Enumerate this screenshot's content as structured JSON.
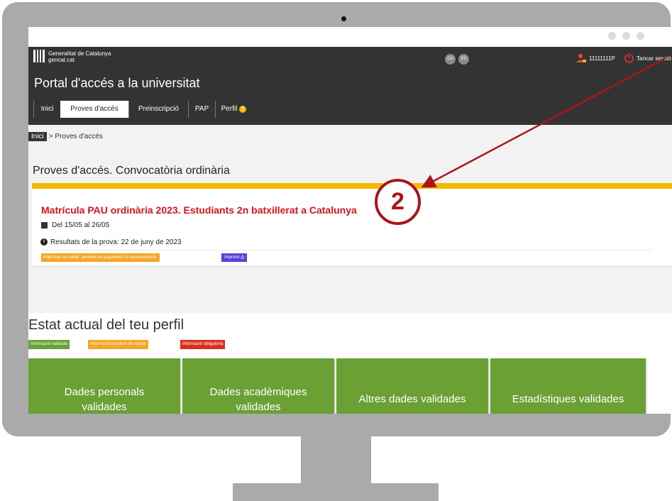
{
  "header": {
    "org_line1": "Generalitat de Catalunya",
    "org_line2": "gencat.cat",
    "lang_ca": "CA",
    "lang_es": "ES",
    "user_id": "11111111P",
    "logout": "Tancar sessió",
    "portal_title": "Portal d'accés a la universitat"
  },
  "tabs": [
    {
      "label": "Inici"
    },
    {
      "label": "Proves d'accés"
    },
    {
      "label": "Preinscripció"
    },
    {
      "label": "PAP"
    },
    {
      "label": "Perfil"
    }
  ],
  "tab_badge": "!",
  "breadcrumb": {
    "home": "Inici",
    "current": "> Proves d'accés"
  },
  "page_title": "Proves d'accés. Convocatòria ordinària",
  "card": {
    "title": "Matrícula PAU ordinària 2023. Estudiants 2n batxillerat a Catalunya",
    "dates": "Del 15/05 al 26/05",
    "results": "Resultats de la prova: 22 de juny de 2023",
    "status_tag": "Matrícula no vàlida: pendent de pagament i/o documentació.",
    "print_button": "Imprimir"
  },
  "profile": {
    "title": "Estat actual del teu perfil",
    "legend": [
      {
        "label": "Informació validada",
        "color": "#6aa034"
      },
      {
        "label": "Informació pendent de validar",
        "color": "#f5a623"
      },
      {
        "label": "Informació obligatòria",
        "color": "#d9301c"
      }
    ],
    "tiles": [
      {
        "label": "Dades personals validades"
      },
      {
        "label": "Dades acadèmiques validades"
      },
      {
        "label": "Altres dades validades"
      },
      {
        "label": "Estadístiques validades"
      }
    ]
  },
  "annotation": {
    "number": "2",
    "color": "#a8151c"
  },
  "colors": {
    "header_bg": "#333333",
    "accent_yellow": "#f5b700",
    "title_red": "#d3151f",
    "tile_green": "#6aa034"
  }
}
